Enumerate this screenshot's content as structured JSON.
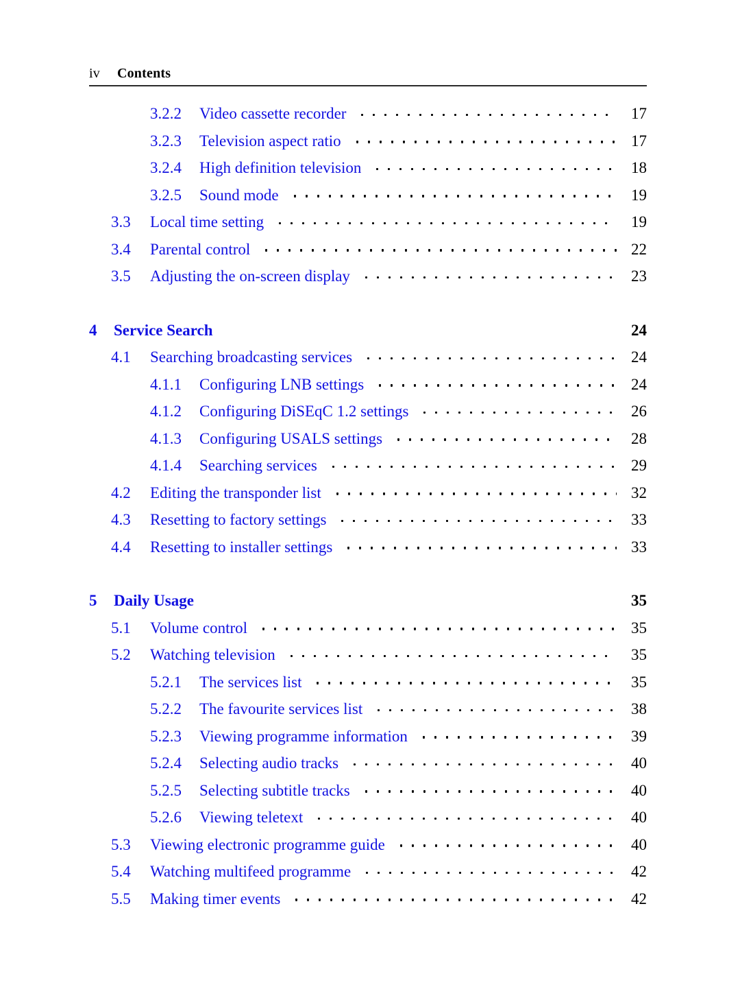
{
  "header": {
    "folio": "iv",
    "title": "Contents"
  },
  "colors": {
    "entry_blue": "#1111e0",
    "page_number_black": "#000000",
    "rule_gray": "#2b2b2b"
  },
  "toc": {
    "entries": [
      {
        "level": 3,
        "number": "3.2.2",
        "label": "Video cassette recorder",
        "page": "17"
      },
      {
        "level": 3,
        "number": "3.2.3",
        "label": "Television aspect ratio",
        "page": "17"
      },
      {
        "level": 3,
        "number": "3.2.4",
        "label": "High definition television",
        "page": "18"
      },
      {
        "level": 3,
        "number": "3.2.5",
        "label": "Sound mode",
        "page": "19"
      },
      {
        "level": 2,
        "number": "3.3",
        "label": "Local time setting",
        "page": "19"
      },
      {
        "level": 2,
        "number": "3.4",
        "label": "Parental control",
        "page": "22"
      },
      {
        "level": 2,
        "number": "3.5",
        "label": "Adjusting the on-screen display",
        "page": "23"
      },
      {
        "level": 1,
        "number": "4",
        "label": "Service Search",
        "page": "24"
      },
      {
        "level": 2,
        "number": "4.1",
        "label": "Searching broadcasting services",
        "page": "24"
      },
      {
        "level": 3,
        "number": "4.1.1",
        "label": "Configuring LNB settings",
        "page": "24"
      },
      {
        "level": 3,
        "number": "4.1.2",
        "label": "Configuring DiSEqC 1.2 settings",
        "page": "26"
      },
      {
        "level": 3,
        "number": "4.1.3",
        "label": "Configuring USALS settings",
        "page": "28"
      },
      {
        "level": 3,
        "number": "4.1.4",
        "label": "Searching services",
        "page": "29"
      },
      {
        "level": 2,
        "number": "4.2",
        "label": "Editing the transponder list",
        "page": "32"
      },
      {
        "level": 2,
        "number": "4.3",
        "label": "Resetting to factory settings",
        "page": "33"
      },
      {
        "level": 2,
        "number": "4.4",
        "label": "Resetting to installer settings",
        "page": "33"
      },
      {
        "level": 1,
        "number": "5",
        "label": "Daily Usage",
        "page": "35"
      },
      {
        "level": 2,
        "number": "5.1",
        "label": "Volume control",
        "page": "35"
      },
      {
        "level": 2,
        "number": "5.2",
        "label": "Watching television",
        "page": "35"
      },
      {
        "level": 3,
        "number": "5.2.1",
        "label": "The services list",
        "page": "35"
      },
      {
        "level": 3,
        "number": "5.2.2",
        "label": "The favourite services list",
        "page": "38"
      },
      {
        "level": 3,
        "number": "5.2.3",
        "label": "Viewing programme information",
        "page": "39"
      },
      {
        "level": 3,
        "number": "5.2.4",
        "label": "Selecting audio tracks",
        "page": "40"
      },
      {
        "level": 3,
        "number": "5.2.5",
        "label": "Selecting subtitle tracks",
        "page": "40"
      },
      {
        "level": 3,
        "number": "5.2.6",
        "label": "Viewing teletext",
        "page": "40"
      },
      {
        "level": 2,
        "number": "5.3",
        "label": "Viewing electronic programme guide",
        "page": "40"
      },
      {
        "level": 2,
        "number": "5.4",
        "label": "Watching multifeed programme",
        "page": "42"
      },
      {
        "level": 2,
        "number": "5.5",
        "label": "Making timer events",
        "page": "42"
      }
    ]
  }
}
